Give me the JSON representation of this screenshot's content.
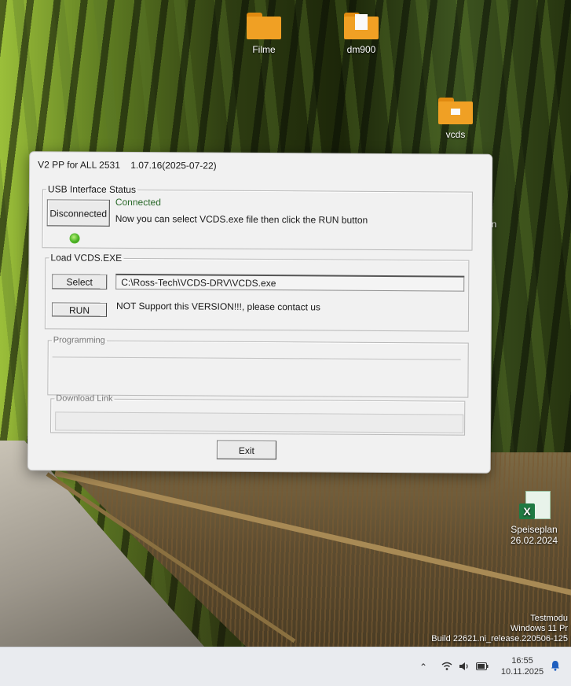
{
  "desktop": {
    "icons": [
      {
        "label": "Filme",
        "kind": "folder"
      },
      {
        "label": "dm900",
        "kind": "folder"
      },
      {
        "label": "vcds",
        "kind": "folder"
      },
      {
        "label": "Speiseplan\n26.02.2024",
        "kind": "excel-file"
      }
    ],
    "partial_label": "en",
    "watermark": {
      "line1": "Testmodu",
      "line2": "Windows 11 Pr",
      "line3": "Build 22621.ni_release.220506-125"
    }
  },
  "window": {
    "title_app": "V2 PP for ALL 2531",
    "title_version": "1.07.16(2025-07-22)",
    "usb_group": {
      "legend": "USB Interface Status",
      "disconnected_button": "Disconnected",
      "status": "Connected",
      "message": "Now you can select VCDS.exe file then click the RUN button",
      "led_color": "#52b82a"
    },
    "load_group": {
      "legend": "Load VCDS.EXE",
      "select_button": "Select",
      "path_value": "C:\\Ross-Tech\\VCDS-DRV\\VCDS.exe",
      "run_button": "RUN",
      "run_message": "NOT Support this VERSION!!!, please contact us"
    },
    "programming_group": {
      "legend": "Programming"
    },
    "download_group": {
      "legend": "Download Link"
    },
    "exit_button": "Exit"
  },
  "taskbar": {
    "time": "16:55",
    "date": "10.11.2025"
  }
}
